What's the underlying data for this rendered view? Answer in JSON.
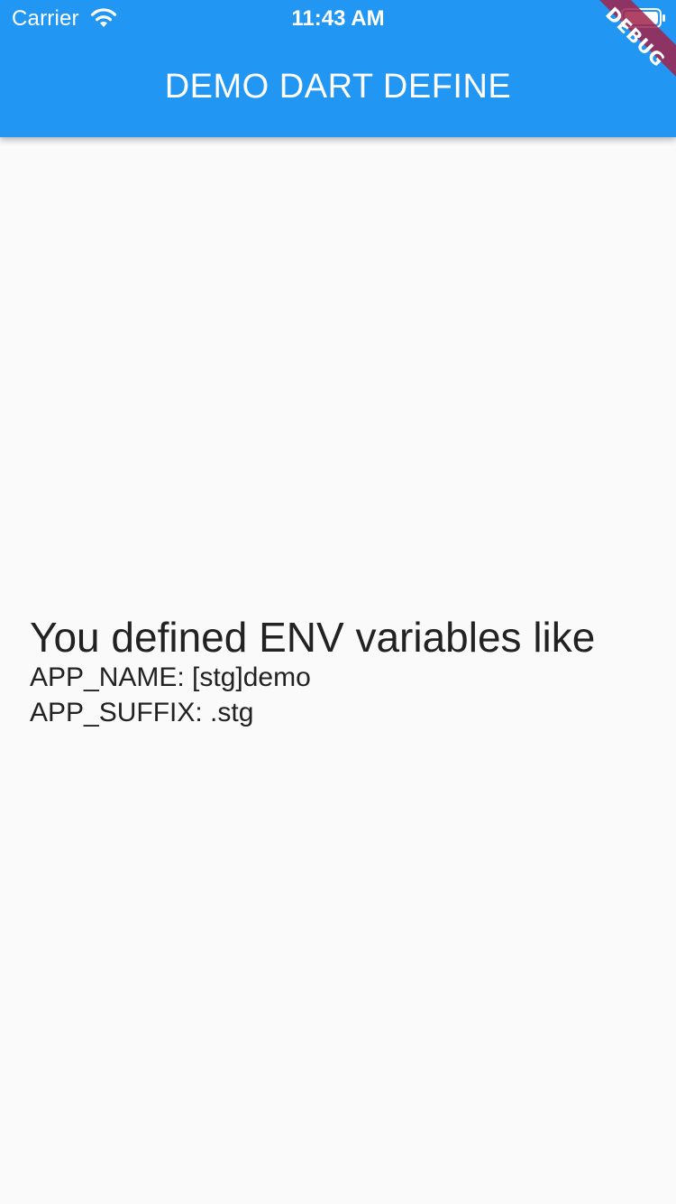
{
  "status_bar": {
    "carrier": "Carrier",
    "time": "11:43 AM",
    "wifi_icon": "wifi-icon",
    "battery_icon": "battery-icon"
  },
  "app_bar": {
    "title": "DEMO DART DEFINE",
    "color": "#2196f3"
  },
  "debug_banner": {
    "label": "DEBUG",
    "color": "#a0234b"
  },
  "body": {
    "headline": "You defined ENV variables like",
    "env_lines": [
      "APP_NAME: [stg]demo",
      "APP_SUFFIX: .stg"
    ]
  }
}
